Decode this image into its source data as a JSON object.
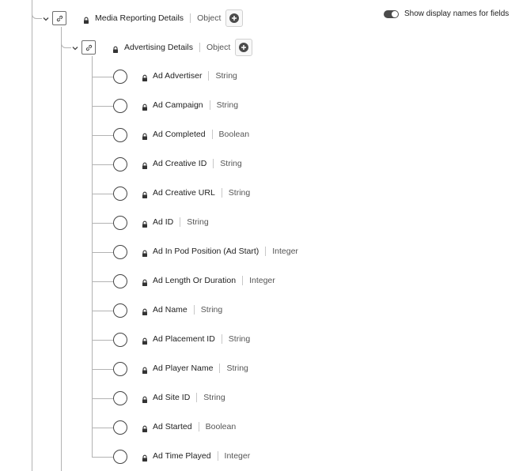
{
  "toggle": {
    "label": "Show display names for fields",
    "on": true
  },
  "parent": {
    "name": "Media Reporting Details",
    "type": "Object"
  },
  "child": {
    "name": "Advertising Details",
    "type": "Object"
  },
  "fields": [
    {
      "name": "Ad Advertiser",
      "type": "String"
    },
    {
      "name": "Ad Campaign",
      "type": "String"
    },
    {
      "name": "Ad Completed",
      "type": "Boolean"
    },
    {
      "name": "Ad Creative ID",
      "type": "String"
    },
    {
      "name": "Ad Creative URL",
      "type": "String"
    },
    {
      "name": "Ad ID",
      "type": "String"
    },
    {
      "name": "Ad In Pod Position (Ad Start)",
      "type": "Integer"
    },
    {
      "name": "Ad Length Or Duration",
      "type": "Integer"
    },
    {
      "name": "Ad Name",
      "type": "String"
    },
    {
      "name": "Ad Placement ID",
      "type": "String"
    },
    {
      "name": "Ad Player Name",
      "type": "String"
    },
    {
      "name": "Ad Site ID",
      "type": "String"
    },
    {
      "name": "Ad Started",
      "type": "Boolean"
    },
    {
      "name": "Ad Time Played",
      "type": "Integer"
    }
  ]
}
